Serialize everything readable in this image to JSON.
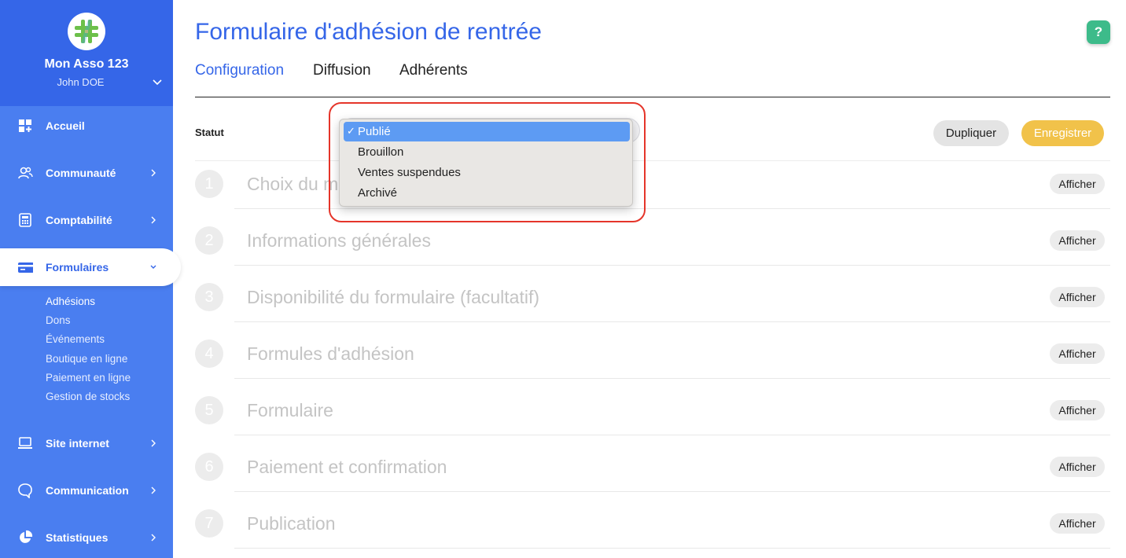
{
  "sidebar": {
    "org_name": "Mon Asso 123",
    "user_name": "John DOE",
    "items": [
      {
        "label": "Accueil"
      },
      {
        "label": "Communauté"
      },
      {
        "label": "Comptabilité"
      },
      {
        "label": "Formulaires"
      },
      {
        "label": "Site internet"
      },
      {
        "label": "Communication"
      },
      {
        "label": "Statistiques"
      }
    ],
    "sub_items": [
      {
        "label": "Adhésions"
      },
      {
        "label": "Dons"
      },
      {
        "label": "Événements"
      },
      {
        "label": "Boutique en ligne"
      },
      {
        "label": "Paiement en ligne"
      },
      {
        "label": "Gestion de stocks"
      }
    ]
  },
  "header": {
    "title": "Formulaire d'adhésion de rentrée",
    "help_label": "?",
    "tabs": [
      {
        "label": "Configuration"
      },
      {
        "label": "Diffusion"
      },
      {
        "label": "Adhérents"
      }
    ]
  },
  "status": {
    "label": "Statut",
    "options": [
      {
        "label": "Publié"
      },
      {
        "label": "Brouillon"
      },
      {
        "label": "Ventes suspendues"
      },
      {
        "label": "Archivé"
      }
    ],
    "check": "✓",
    "selected": "Publié"
  },
  "actions": {
    "duplicate": "Dupliquer",
    "save": "Enregistrer"
  },
  "steps": [
    {
      "number": "1",
      "title": "Choix du m",
      "button": "Afficher"
    },
    {
      "number": "2",
      "title": "Informations générales",
      "button": "Afficher"
    },
    {
      "number": "3",
      "title": "Disponibilité du formulaire (facultatif)",
      "button": "Afficher"
    },
    {
      "number": "4",
      "title": "Formules d'adhésion",
      "button": "Afficher"
    },
    {
      "number": "5",
      "title": "Formulaire",
      "button": "Afficher"
    },
    {
      "number": "6",
      "title": "Paiement et confirmation",
      "button": "Afficher"
    },
    {
      "number": "7",
      "title": "Publication",
      "button": "Afficher"
    }
  ],
  "colors": {
    "brand_blue": "#3566e8",
    "sidebar_blue": "#4a7ef0",
    "save_yellow": "#f1c24a",
    "help_green": "#3dbb8a",
    "highlight_red": "#e5352a"
  }
}
